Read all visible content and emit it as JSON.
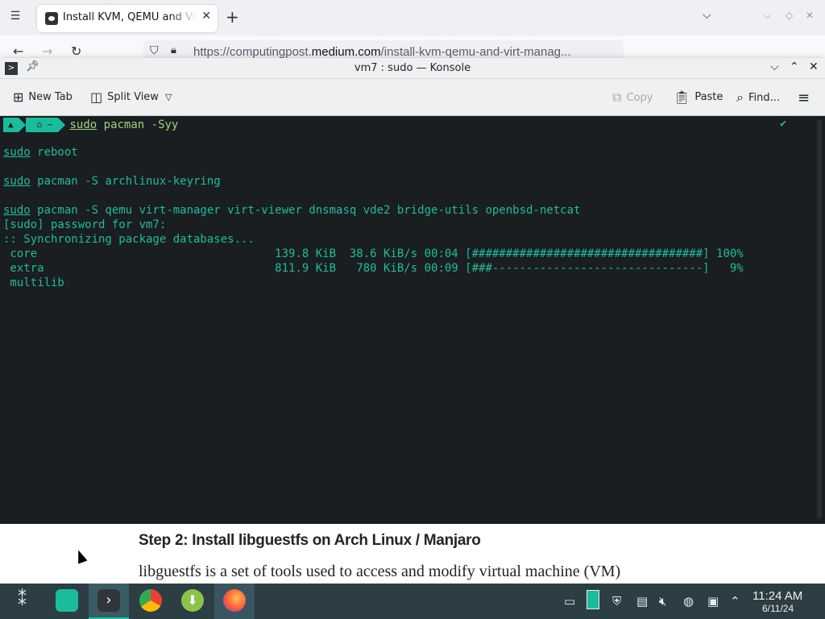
{
  "browser": {
    "tab_title": "Install KVM, QEMU and Virt Manager on Arch Linux",
    "url_prefix": "https://computingpost.",
    "url_host": "medium.com",
    "url_path": "/install-kvm-qemu-and-virt-manag..."
  },
  "konsole": {
    "title": "vm7 : sudo — Konsole",
    "toolbar": {
      "new_tab": "New Tab",
      "split_view": "Split View",
      "copy": "Copy",
      "paste": "Paste",
      "find": "Find..."
    },
    "terminal": {
      "prompt_home": "~",
      "prompt_cmd_sudo": "sudo",
      "prompt_cmd_rest": " pacman -Syy",
      "line_reboot_sudo": "sudo",
      "line_reboot_rest": " reboot",
      "line_keyring_sudo": "sudo",
      "line_keyring_rest": " pacman -S archlinux-keyring",
      "line_install_sudo": "sudo",
      "line_install_rest": " pacman -S qemu virt-manager virt-viewer dnsmasq vde2 bridge-utils openbsd-netcat",
      "line_password": "[sudo] password for vm7:",
      "line_sync": ":: Synchronizing package databases...",
      "line_core": " core                                   139.8 KiB  38.6 KiB/s 00:04 [##################################] 100%",
      "line_extra": " extra                                  811.9 KiB   780 KiB/s 00:09 [###-------------------------------]   9%",
      "line_multilib": " multilib"
    }
  },
  "page": {
    "step_heading": "Step 2: Install libguestfs on Arch Linux / Manjaro",
    "step_body": "libguestfs is a set of tools used to access and modify virtual machine (VM)"
  },
  "taskbar": {
    "time": "11:24 AM",
    "date": "6/11/24"
  },
  "colors": {
    "terminal_bg": "#1b1e20",
    "terminal_fg": "#1abc9c",
    "taskbar_bg": "#2c3e44"
  }
}
